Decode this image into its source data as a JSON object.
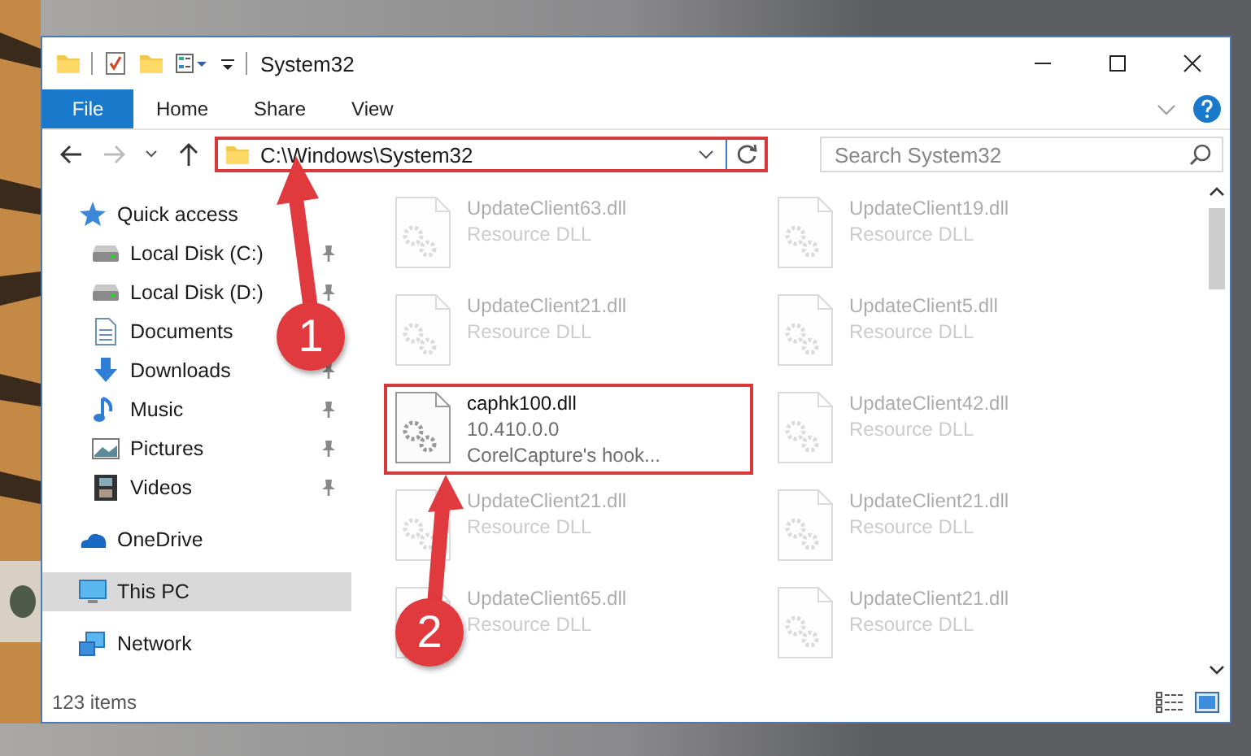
{
  "window": {
    "title": "System32"
  },
  "ribbon_tabs": [
    {
      "label": "File",
      "kind": "menu"
    },
    {
      "label": "Home",
      "kind": "tab"
    },
    {
      "label": "Share",
      "kind": "tab"
    },
    {
      "label": "View",
      "kind": "tab"
    }
  ],
  "address_bar": {
    "value": "C:\\Windows\\System32",
    "highlighted": true
  },
  "search": {
    "placeholder": "Search System32"
  },
  "sidebar": {
    "items": [
      {
        "label": "Quick access",
        "kind": "star",
        "selected": false,
        "children": [
          {
            "label": "Local Disk (C:)",
            "kind": "drive",
            "pinned": true,
            "selected": false
          },
          {
            "label": "Local Disk (D:)",
            "kind": "drive",
            "pinned": true,
            "selected": false
          },
          {
            "label": "Documents",
            "kind": "document",
            "selected": false
          },
          {
            "label": "Downloads",
            "kind": "download",
            "pinned": true,
            "selected": false
          },
          {
            "label": "Music",
            "kind": "music",
            "pinned": true,
            "selected": false
          },
          {
            "label": "Pictures",
            "kind": "pictures",
            "pinned": true,
            "selected": false
          },
          {
            "label": "Videos",
            "kind": "videos",
            "pinned": true,
            "selected": false
          }
        ]
      },
      {
        "label": "OneDrive",
        "kind": "cloud",
        "selected": false
      },
      {
        "label": "This PC",
        "kind": "computer",
        "selected": true
      },
      {
        "label": "Network",
        "kind": "network",
        "selected": false
      }
    ]
  },
  "files": [
    {
      "name": "UpdateClient63.dll",
      "lines": [
        "Resource DLL"
      ],
      "dimmed": true,
      "highlighted": false
    },
    {
      "name": "UpdateClient19.dll",
      "lines": [
        "Resource DLL"
      ],
      "dimmed": true,
      "highlighted": false
    },
    {
      "name": "UpdateClient21.dll",
      "lines": [
        "Resource DLL"
      ],
      "dimmed": true,
      "highlighted": false
    },
    {
      "name": "UpdateClient5.dll",
      "lines": [
        "Resource DLL"
      ],
      "dimmed": true,
      "highlighted": false
    },
    {
      "name": "caphk100.dll",
      "lines": [
        "10.410.0.0",
        "CorelCapture's hook..."
      ],
      "dimmed": false,
      "highlighted": true
    },
    {
      "name": "UpdateClient42.dll",
      "lines": [
        "Resource DLL"
      ],
      "dimmed": true,
      "highlighted": false
    },
    {
      "name": "UpdateClient21.dll",
      "lines": [
        "Resource DLL"
      ],
      "dimmed": true,
      "highlighted": false
    },
    {
      "name": "UpdateClient21.dll",
      "lines": [
        "Resource DLL"
      ],
      "dimmed": true,
      "highlighted": false
    },
    {
      "name": "UpdateClient65.dll",
      "lines": [
        "Resource DLL"
      ],
      "dimmed": true,
      "highlighted": false
    },
    {
      "name": "UpdateClient21.dll",
      "lines": [
        "Resource DLL"
      ],
      "dimmed": true,
      "highlighted": false
    }
  ],
  "status_bar": {
    "text": "123 items"
  },
  "annotations": [
    {
      "number": "1"
    },
    {
      "number": "2"
    }
  ]
}
